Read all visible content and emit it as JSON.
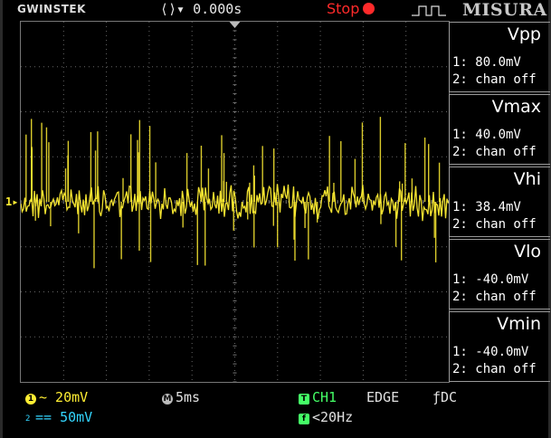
{
  "header": {
    "brand": "GWINSTEK",
    "time_offset": "0.000s",
    "run_state": "Stop",
    "logo": "MISURA"
  },
  "channel_marker": "1",
  "measurements": [
    {
      "label": "Vpp",
      "ch1": "1: 80.0mV",
      "ch2": "2: chan off"
    },
    {
      "label": "Vmax",
      "ch1": "1: 40.0mV",
      "ch2": "2: chan off"
    },
    {
      "label": "Vhi",
      "ch1": "1: 38.4mV",
      "ch2": "2: chan off"
    },
    {
      "label": "Vlo",
      "ch1": "1: -40.0mV",
      "ch2": "2: chan off"
    },
    {
      "label": "Vmin",
      "ch1": "1: -40.0mV",
      "ch2": "2: chan off"
    }
  ],
  "status": {
    "ch1_badge": "1",
    "ch1_scale": "~ 20mV",
    "ch2_badge": "2",
    "ch2_scale": "== 50mV",
    "timebase_badge": "M",
    "timebase": "5ms",
    "trigger_badge": "T",
    "trigger_source": "CH1",
    "trigger_type": "EDGE",
    "coupling": "DC",
    "filter_badge": "f",
    "filter": "<20Hz"
  },
  "colors": {
    "trace": "#ffee33",
    "stop": "#ff2a2a",
    "ch2": "#33d6ff",
    "trigger": "#44ff66"
  }
}
